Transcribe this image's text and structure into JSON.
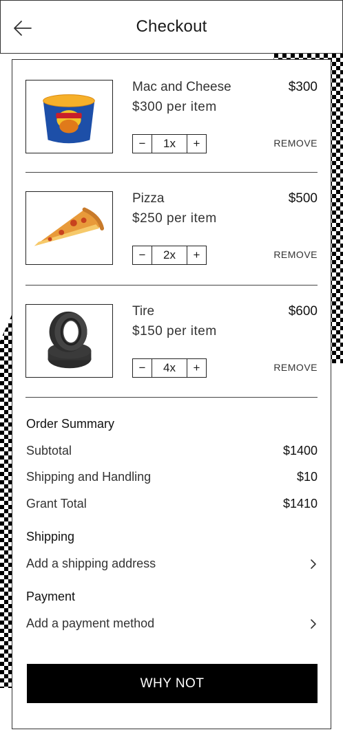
{
  "header": {
    "title": "Checkout",
    "back_icon": "arrow-left-icon"
  },
  "cart": {
    "items": [
      {
        "name": "Mac and Cheese",
        "unit_price": "$300 per item",
        "total": "$300",
        "quantity": "1x",
        "remove_label": "REMOVE",
        "image": "mac-and-cheese-cup-image"
      },
      {
        "name": "Pizza",
        "unit_price": "$250 per item",
        "total": "$500",
        "quantity": "2x",
        "remove_label": "REMOVE",
        "image": "pizza-slice-image"
      },
      {
        "name": "Tire",
        "unit_price": "$150 per item",
        "total": "$600",
        "quantity": "4x",
        "remove_label": "REMOVE",
        "image": "stacked-tires-image"
      }
    ],
    "stepper": {
      "minus": "−",
      "plus": "+"
    }
  },
  "summary": {
    "title": "Order Summary",
    "subtotal_label": "Subtotal",
    "subtotal_value": "$1400",
    "shipping_label": "Shipping and Handling",
    "shipping_value": "$10",
    "total_label": "Grant Total",
    "total_value": "$1410"
  },
  "shipping": {
    "title": "Shipping",
    "link_label": "Add a shipping address"
  },
  "payment": {
    "title": "Payment",
    "link_label": "Add a payment method"
  },
  "cta": {
    "label": "WHY NOT"
  },
  "colors": {
    "accent": "#000000",
    "border": "#333333",
    "text": "#1a1a1a"
  }
}
